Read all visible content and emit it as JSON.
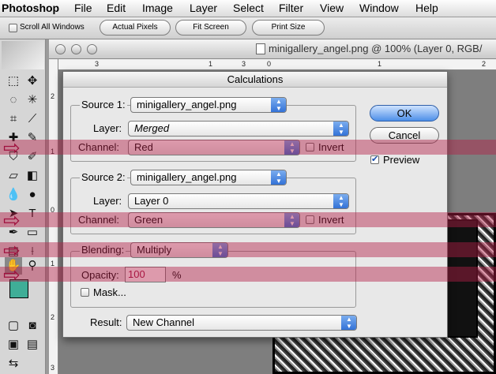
{
  "menubar": {
    "app": "Photoshop",
    "items": [
      "File",
      "Edit",
      "Image",
      "Layer",
      "Select",
      "Filter",
      "View",
      "Window",
      "Help"
    ]
  },
  "options": {
    "scroll_all": "Scroll All Windows",
    "actual_pixels": "Actual Pixels",
    "fit_screen": "Fit Screen",
    "print_size": "Print Size"
  },
  "document": {
    "title": "minigallery_angel.png @ 100% (Layer 0, RGB/",
    "ruler_h": [
      "3",
      "1",
      "3",
      "0",
      "1",
      "2"
    ],
    "ruler_v": [
      "2",
      "1",
      "0",
      "1",
      "2",
      "3"
    ]
  },
  "dialog": {
    "title": "Calculations",
    "source1": {
      "label": "Source 1:",
      "value": "minigallery_angel.png",
      "layer_label": "Layer:",
      "layer": "Merged",
      "channel_label": "Channel:",
      "channel": "Red",
      "invert": "Invert"
    },
    "source2": {
      "label": "Source 2:",
      "value": "minigallery_angel.png",
      "layer_label": "Layer:",
      "layer": "Layer 0",
      "channel_label": "Channel:",
      "channel": "Green",
      "invert": "Invert"
    },
    "blending": {
      "label": "Blending:",
      "value": "Multiply",
      "opacity_label": "Opacity:",
      "opacity": "100",
      "unit": "%",
      "mask": "Mask..."
    },
    "result": {
      "label": "Result:",
      "value": "New Channel"
    },
    "ok": "OK",
    "cancel": "Cancel",
    "preview": "Preview",
    "preview_checked": true
  },
  "colors": {
    "highlight": "#b41e46",
    "swatch_fg": "#3fae97",
    "ok_blue": "#4d8fe8"
  }
}
